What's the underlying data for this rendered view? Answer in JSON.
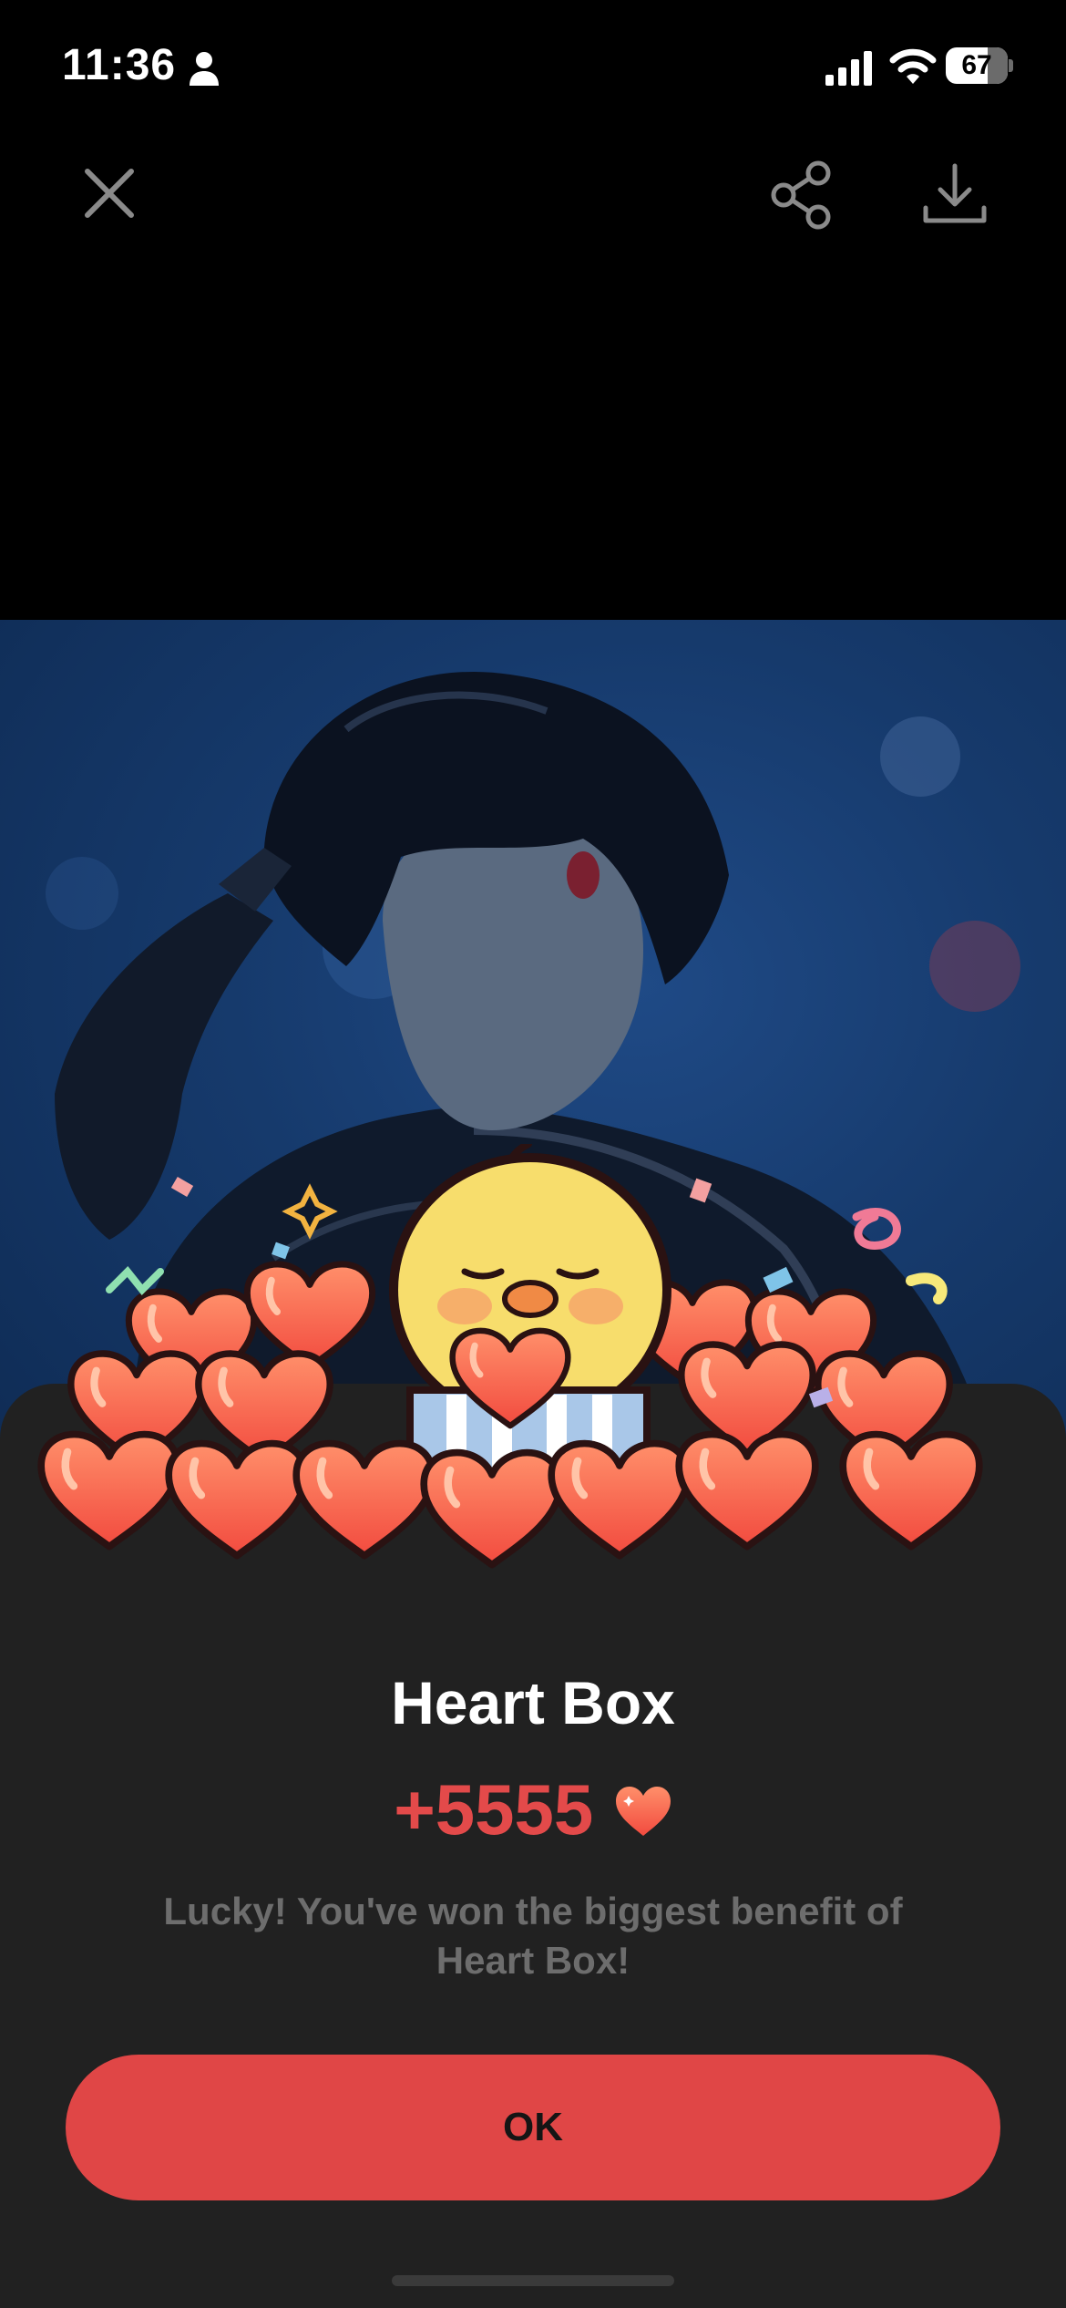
{
  "status_bar": {
    "time": "11:36",
    "battery_percent": "67",
    "battery_level": 0.67
  },
  "toolbar": {
    "close_icon": "close-icon",
    "share_icon": "share-icon",
    "download_icon": "download-icon"
  },
  "photo": {
    "description_icon": "photo"
  },
  "dialog": {
    "title": "Heart Box",
    "reward_amount": "+5555",
    "reward_icon": "heart-icon",
    "message": "Lucky! You've won the biggest benefit of Heart Box!",
    "ok_label": "OK"
  },
  "colors": {
    "accent": "#e04646",
    "reward_text": "#e34a4a",
    "sheet_background": "#212121",
    "message_text": "#6d6d6d"
  }
}
